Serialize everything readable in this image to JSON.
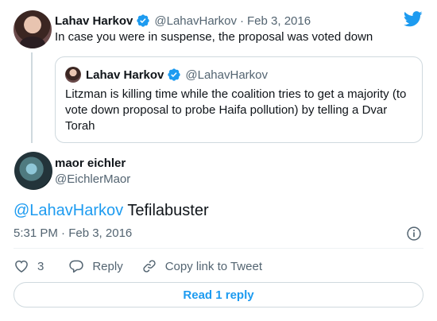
{
  "parent_tweet": {
    "name": "Lahav Harkov",
    "handle": "@LahavHarkov",
    "separator": "·",
    "date": "Feb 3, 2016",
    "text": "In case you were in suspense, the proposal was voted down"
  },
  "quoted_tweet": {
    "name": "Lahav Harkov",
    "handle": "@LahavHarkov",
    "text": "Litzman is killing time while the coalition tries to get a majority (to vote down proposal to probe Haifa pollution) by telling a Dvar Torah"
  },
  "main_tweet": {
    "name": "maor eichler",
    "handle": "@EichlerMaor",
    "mention": "@LahavHarkov",
    "text": " Tefilabuster",
    "timestamp": "5:31 PM · Feb 3, 2016"
  },
  "actions": {
    "like_count": "3",
    "reply_label": "Reply",
    "copy_label": "Copy link to Tweet"
  },
  "read_replies_label": "Read 1 reply",
  "colors": {
    "accent": "#1d9bf0",
    "secondary_text": "#536471",
    "border": "#cfd9de"
  },
  "icons": {
    "brand": "twitter-bird-icon",
    "verified": "verified-badge-icon",
    "info": "info-icon",
    "like": "heart-icon",
    "reply": "reply-bubble-icon",
    "copy": "link-icon"
  }
}
